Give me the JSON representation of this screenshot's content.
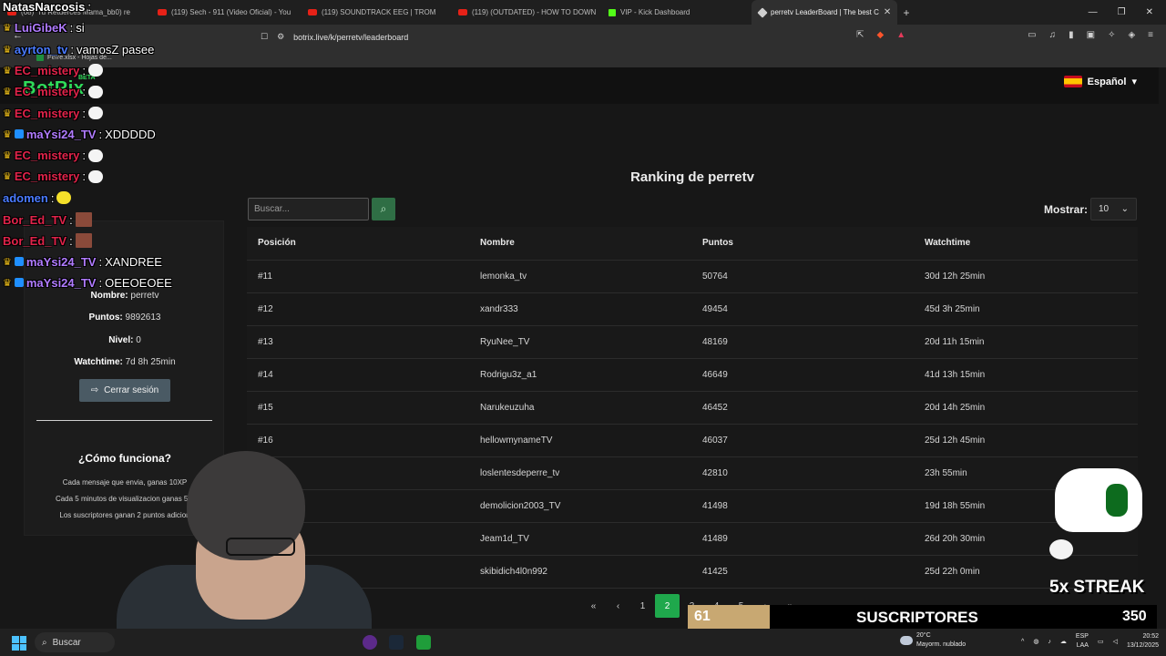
{
  "browser": {
    "tabs": [
      {
        "label": "(68) 'Tu Retuerces Mama_bb0) re",
        "type": "youtube"
      },
      {
        "label": "(119) Sech - 911 (Video Oficial) - You",
        "type": "youtube"
      },
      {
        "label": "(119) SOUNDTRACK EEG | TROM",
        "type": "youtube"
      },
      {
        "label": "(119) (OUTDATED) - HOW TO DOWN",
        "type": "youtube"
      },
      {
        "label": "VIP - Kick Dashboard",
        "type": "kick"
      },
      {
        "label": "perretv LeaderBoard | The best C",
        "type": "botrix",
        "active": true
      }
    ],
    "url": "botrix.live/k/perretv/leaderboard",
    "bookmark": "Perre.xlsx - Hojas de..."
  },
  "site": {
    "logo": "BotRix",
    "beta": "BETA",
    "language": "Español"
  },
  "sidebar": {
    "nombre_label": "Nombre:",
    "nombre_value": "perretv",
    "puntos_label": "Puntos:",
    "puntos_value": "9892613",
    "nivel_label": "Nivel:",
    "nivel_value": "0",
    "watchtime_label": "Watchtime:",
    "watchtime_value": "7d 8h 25min",
    "logout_label": "Cerrar sesión",
    "how_title": "¿Cómo funciona?",
    "how_lines": [
      "Cada mensaje que envia, ganas 10XP",
      "Cada 5 minutos de visualizacion ganas 5 p",
      "Los suscriptores ganan 2 puntos adicion"
    ]
  },
  "leaderboard": {
    "title": "Ranking de perretv",
    "search_placeholder": "Buscar...",
    "show_label": "Mostrar:",
    "show_value": "10",
    "columns": [
      "Posición",
      "Nombre",
      "Puntos",
      "Watchtime"
    ],
    "rows": [
      [
        "#11",
        "lemonka_tv",
        "50764",
        "30d 12h 25min"
      ],
      [
        "#12",
        "xandr333",
        "49454",
        "45d 3h 25min"
      ],
      [
        "#13",
        "RyuNee_TV",
        "48169",
        "20d 11h 15min"
      ],
      [
        "#14",
        "Rodrigu3z_a1",
        "46649",
        "41d 13h 15min"
      ],
      [
        "#15",
        "Narukeuzuha",
        "46452",
        "20d 14h 25min"
      ],
      [
        "#16",
        "hellowmynameTV",
        "46037",
        "25d 12h 45min"
      ],
      [
        "",
        "loslentesdeperre_tv",
        "42810",
        "23h 55min"
      ],
      [
        "",
        "demolicion2003_TV",
        "41498",
        "19d 18h 55min"
      ],
      [
        "",
        "Jeam1d_TV",
        "41489",
        "26d 20h 30min"
      ],
      [
        "",
        "skibidich4l0n992",
        "41425",
        "25d 22h 0min"
      ]
    ],
    "pages": [
      "«",
      "‹",
      "1",
      "2",
      "3",
      "4",
      "5",
      "›",
      "»"
    ],
    "active_page": "2"
  },
  "chat": [
    {
      "user": "NatasNarcosis",
      "color": "#ffffff",
      "msg": "",
      "crown": false
    },
    {
      "user": "LuiGibeK",
      "color": "#b07bff",
      "msg": "si",
      "crown": true
    },
    {
      "user": "ayrton_tv",
      "color": "#4a7bff",
      "msg": "vamosZ pasee",
      "crown": true
    },
    {
      "user": "EC_mistery",
      "color": "#e0234a",
      "msg": "",
      "crown": true,
      "emote": "white"
    },
    {
      "user": "EC_mistery",
      "color": "#e0234a",
      "msg": "",
      "crown": true,
      "emote": "white"
    },
    {
      "user": "EC_mistery",
      "color": "#e0234a",
      "msg": "",
      "crown": true,
      "emote": "white"
    },
    {
      "user": "maYsi24_TV",
      "color": "#b07bff",
      "msg": "XDDDDD",
      "crown": true,
      "badge": true
    },
    {
      "user": "EC_mistery",
      "color": "#e0234a",
      "msg": "",
      "crown": true,
      "emote": "white"
    },
    {
      "user": "EC_mistery",
      "color": "#e0234a",
      "msg": "",
      "crown": true,
      "emote": "white"
    },
    {
      "user": "adomen",
      "color": "#4a7bff",
      "msg": "",
      "crown": false,
      "emote": "yellow"
    },
    {
      "user": "Bor_Ed_TV",
      "color": "#e0234a",
      "msg": "",
      "crown": false,
      "emote": "pic"
    },
    {
      "user": "Bor_Ed_TV",
      "color": "#e0234a",
      "msg": "",
      "crown": false,
      "emote": "pic"
    },
    {
      "user": "maYsi24_TV",
      "color": "#b07bff",
      "msg": "XANDREE",
      "crown": true,
      "badge": true
    },
    {
      "user": "maYsi24_TV",
      "color": "#b07bff",
      "msg": "OEEOEOEE",
      "crown": true,
      "badge": true
    }
  ],
  "overlay": {
    "streak": "5x STREAK",
    "sub_current": "61",
    "sub_label": "SUSCRIPTORES",
    "sub_goal": "350",
    "sub_progress": 0.174
  },
  "taskbar": {
    "search": "Buscar",
    "weather_temp": "20°C",
    "weather_desc": "Mayorm. nublado",
    "lang1": "ESP",
    "lang2": "LAA",
    "time": "20:52",
    "date": "13/12/2025"
  }
}
